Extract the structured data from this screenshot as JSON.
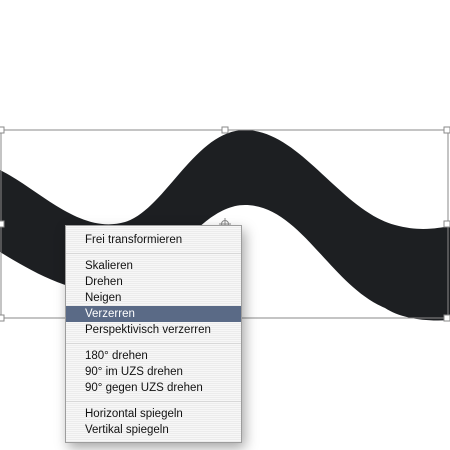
{
  "colors": {
    "shape_fill": "#1d1f22",
    "bounding_box": "#8a8a8a",
    "menu_selected_bg": "#5a6a86"
  },
  "menu": {
    "groups": [
      [
        "Frei transformieren"
      ],
      [
        "Skalieren",
        "Drehen",
        "Neigen",
        "Verzerren",
        "Perspektivisch verzerren"
      ],
      [
        "180° drehen",
        "90° im UZS drehen",
        "90° gegen UZS drehen"
      ],
      [
        "Horizontal spiegeln",
        "Vertikal spiegeln"
      ]
    ],
    "selected": "Verzerren"
  }
}
